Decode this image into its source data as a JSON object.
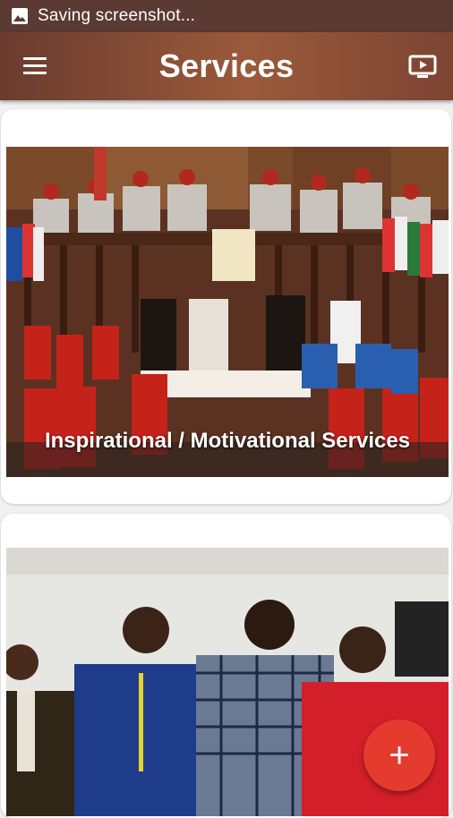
{
  "status_bar": {
    "text": "Saving screenshot...",
    "icon": "image-icon"
  },
  "app_bar": {
    "title": "Services",
    "menu_icon": "hamburger-menu-icon",
    "action_icon": "cast-tv-icon"
  },
  "cards": [
    {
      "caption": "Inspirational / Motivational Services"
    },
    {
      "caption": ""
    }
  ],
  "fab": {
    "label": "+",
    "icon": "plus-icon",
    "color": "#e53b2e"
  },
  "colors": {
    "app_bar_brown": "#8a4a33",
    "status_bar": "#5a3a33"
  }
}
